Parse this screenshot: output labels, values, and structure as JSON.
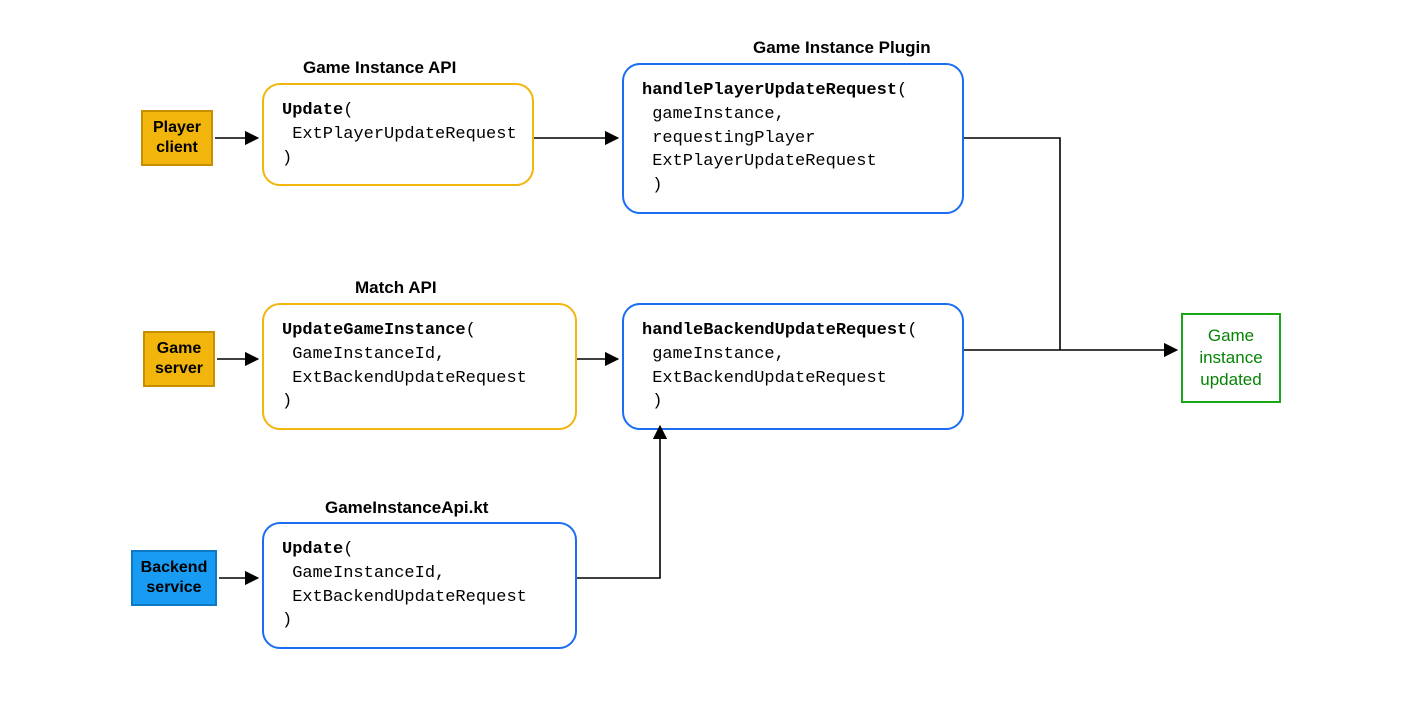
{
  "sources": {
    "playerClient": "Player client",
    "gameServer": "Game server",
    "backendService": "Backend service"
  },
  "titles": {
    "gameInstanceApi": "Game Instance API",
    "gameInstancePlugin": "Game Instance Plugin",
    "matchApi": "Match API",
    "gameInstanceApiKt": "GameInstanceApi.kt"
  },
  "boxes": {
    "updatePlayer": {
      "fn": "Update",
      "args": [
        "ExtPlayerUpdateRequest"
      ]
    },
    "handlePlayerUpdate": {
      "fn": "handlePlayerUpdateRequest",
      "args": [
        "gameInstance,",
        "requestingPlayer",
        "ExtPlayerUpdateRequest"
      ]
    },
    "updateGameInstance": {
      "fn": "UpdateGameInstance",
      "args": [
        "GameInstanceId,",
        "ExtBackendUpdateRequest"
      ]
    },
    "handleBackendUpdate": {
      "fn": "handleBackendUpdateRequest",
      "args": [
        "gameInstance,",
        "ExtBackendUpdateRequest"
      ]
    },
    "updateBackend": {
      "fn": "Update",
      "args": [
        "GameInstanceId,",
        "ExtBackendUpdateRequest"
      ]
    }
  },
  "result": "Game instance updated"
}
